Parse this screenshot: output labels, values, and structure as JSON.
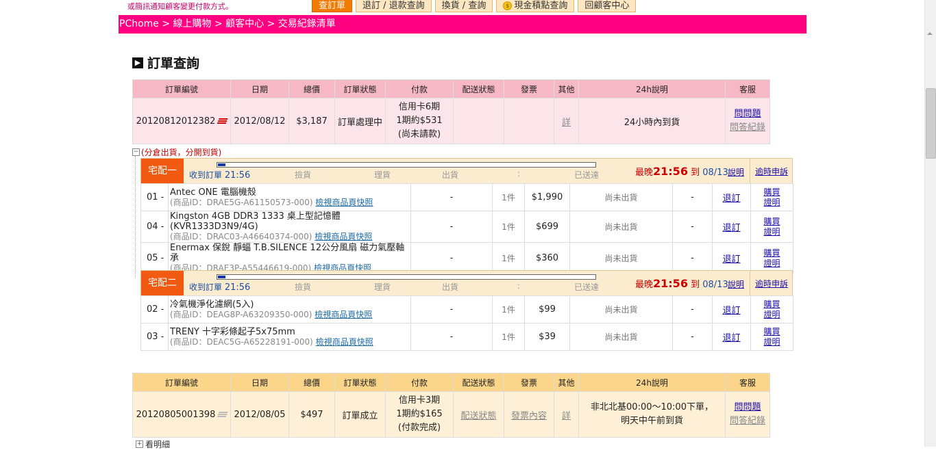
{
  "top": {
    "notice": "或簡訊通知顧客變更付款方式。",
    "tabs": [
      {
        "label": "查訂單",
        "active": true
      },
      {
        "label": "退訂 / 退款查詢",
        "active": false
      },
      {
        "label": "換貨 / 查詢",
        "active": false
      },
      {
        "label": "現金積點查詢",
        "active": false,
        "icon": "coin-icon"
      },
      {
        "label": "回顧客中心",
        "active": false
      }
    ]
  },
  "breadcrumb": "PChome > 線上購物 > 顧客中心 > 交易紀錄清單",
  "page_title": "訂單查詢",
  "table_headers": [
    "訂單編號",
    "日期",
    "總價",
    "訂單狀態",
    "付款",
    "配送狀態",
    "發票",
    "其他",
    "24h說明",
    "客服"
  ],
  "orders": [
    {
      "number": "20120812012382",
      "date": "2012/08/12",
      "total": "$3,187",
      "status": "訂單處理中",
      "payment": [
        "信用卡6期",
        "1期約$531",
        "(尚未請款)"
      ],
      "delivery": "",
      "invoice": "",
      "other": "詳",
      "h24": "24小時內到貨",
      "cs": [
        "問問題",
        "問答紀錄"
      ]
    },
    {
      "number": "20120805001398",
      "date": "2012/08/05",
      "total": "$497",
      "status": "訂單成立",
      "payment": [
        "信用卡3期",
        "1期約$165",
        "(付款完成)"
      ],
      "delivery": "配送狀態",
      "invoice": "發票內容",
      "other": "詳",
      "h24": [
        "非北北基00:00～10:00下單，",
        "明天中午前到貨"
      ],
      "cs": [
        "問問題",
        "問答紀錄"
      ]
    }
  ],
  "split_note": "(分倉出貨，分開到貨)",
  "show_detail": "看明細",
  "shipments": [
    {
      "label": "宅配一",
      "steps": {
        "received": "收到訂單",
        "time": "21:56",
        "pick": "撿貨",
        "sort": "理貨",
        "out": "出貨",
        "colon": ":",
        "delivered": "已送達"
      },
      "progress_percent": 2,
      "latest": {
        "prefix": "最晚",
        "time": "21:56",
        "to": "到",
        "date": "08/13"
      },
      "explain": "說明",
      "overdue": "逾時申訴",
      "items": [
        {
          "seq": "01",
          "name": [
            "Antec ONE 電腦機殼"
          ],
          "pid": "(商品ID：DRAE5G-A61150573-000)",
          "snap": "檢視商品頁快照",
          "dash1": "-",
          "qty": "1件",
          "price": "$1,990",
          "ship": "尚未出貨",
          "dash2": "-",
          "cancel": "退訂",
          "proof": [
            "購買",
            "證明"
          ]
        },
        {
          "seq": "04",
          "name": [
            "Kingston 4GB DDR3 1333 桌上型記憶體",
            "(KVR1333D3N9/4G)"
          ],
          "pid": "(商品ID：DRAC03-A46640374-000)",
          "snap": "檢視商品頁快照",
          "dash1": "-",
          "qty": "1件",
          "price": "$699",
          "ship": "尚未出貨",
          "dash2": "-",
          "cancel": "退訂",
          "proof": [
            "購買",
            "證明"
          ]
        },
        {
          "seq": "05",
          "name": [
            "Enermax 保銳 靜蝠 T.B.SILENCE 12公分風扇 磁力氣壓軸承"
          ],
          "pid": "(商品ID：DRAE3P-A55446619-000)",
          "snap": "檢視商品頁快照",
          "dash1": "-",
          "qty": "1件",
          "price": "$360",
          "ship": "尚未出貨",
          "dash2": "-",
          "cancel": "退訂",
          "proof": [
            "購買",
            "證明"
          ]
        }
      ]
    },
    {
      "label": "宅配二",
      "steps": {
        "received": "收到訂單",
        "time": "21:56",
        "pick": "撿貨",
        "sort": "理貨",
        "out": "出貨",
        "colon": ":",
        "delivered": "已送達"
      },
      "progress_percent": 2,
      "latest": {
        "prefix": "最晚",
        "time": "21:56",
        "to": "到",
        "date": "08/13"
      },
      "explain": "說明",
      "overdue": "逾時申訴",
      "items": [
        {
          "seq": "02",
          "name": [
            "冷氣機淨化濾網(5入)"
          ],
          "pid": "(商品ID：DEAG8P-A63209350-000)",
          "snap": "檢視商品頁快照",
          "dash1": "-",
          "qty": "1件",
          "price": "$99",
          "ship": "尚未出貨",
          "dash2": "-",
          "cancel": "退訂",
          "proof": [
            "購買",
            "證明"
          ]
        },
        {
          "seq": "03",
          "name": [
            "TRENY 十字彩條起子5x75mm"
          ],
          "pid": "(商品ID：DEAC5G-A65228191-000)",
          "snap": "檢視商品頁快照",
          "dash1": "-",
          "qty": "1件",
          "price": "$39",
          "ship": "尚未出貨",
          "dash2": "-",
          "cancel": "退訂",
          "proof": [
            "購買",
            "證明"
          ]
        }
      ]
    }
  ]
}
